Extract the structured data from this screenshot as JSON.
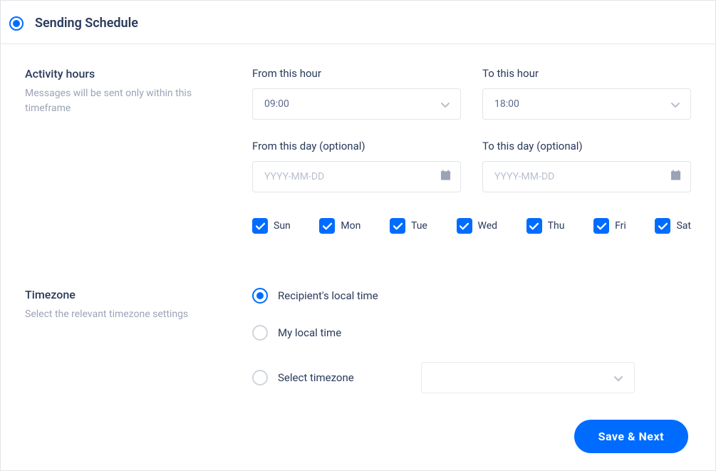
{
  "header": {
    "title": "Sending Schedule"
  },
  "activity": {
    "heading": "Activity hours",
    "description": "Messages will be sent only within this timeframe",
    "from_hour_label": "From this hour",
    "from_hour_value": "09:00",
    "to_hour_label": "To this hour",
    "to_hour_value": "18:00",
    "from_day_label": "From this day (optional)",
    "from_day_placeholder": "YYYY-MM-DD",
    "to_day_label": "To this day (optional)",
    "to_day_placeholder": "YYYY-MM-DD",
    "days": [
      {
        "label": "Sun",
        "checked": true
      },
      {
        "label": "Mon",
        "checked": true
      },
      {
        "label": "Tue",
        "checked": true
      },
      {
        "label": "Wed",
        "checked": true
      },
      {
        "label": "Thu",
        "checked": true
      },
      {
        "label": "Fri",
        "checked": true
      },
      {
        "label": "Sat",
        "checked": true
      }
    ]
  },
  "timezone": {
    "heading": "Timezone",
    "description": "Select the relevant timezone settings",
    "options": {
      "recipient": "Recipient's local time",
      "my": "My local time",
      "select": "Select timezone"
    },
    "selected": "recipient"
  },
  "footer": {
    "save_label": "Save & Next"
  }
}
